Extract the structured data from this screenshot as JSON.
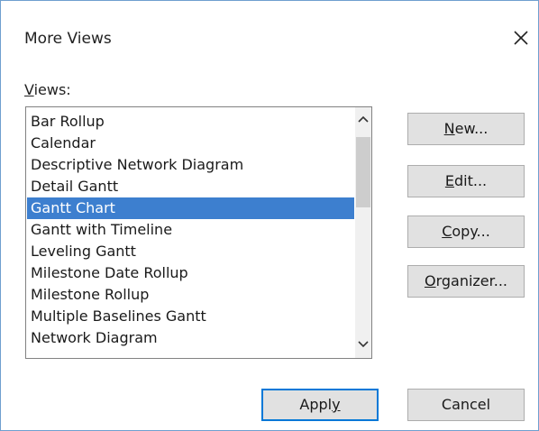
{
  "dialog": {
    "title": "More Views",
    "close_glyph": "close-icon"
  },
  "views_label": {
    "mnemonic": "V",
    "rest": "iews:"
  },
  "views_list": {
    "items": [
      "Bar Rollup",
      "Calendar",
      "Descriptive Network Diagram",
      "Detail Gantt",
      "Gantt Chart",
      "Gantt with Timeline",
      "Leveling Gantt",
      "Milestone Date Rollup",
      "Milestone Rollup",
      "Multiple Baselines Gantt",
      "Network Diagram"
    ],
    "selected": "Gantt Chart",
    "selection_color": "#3d7fcf"
  },
  "buttons": {
    "new": {
      "mnemonic": "N",
      "rest": "ew..."
    },
    "edit": {
      "mnemonic": "E",
      "rest": "dit..."
    },
    "copy": {
      "mnemonic": "C",
      "rest": "opy..."
    },
    "organizer": {
      "mnemonic": "O",
      "rest": "rganizer..."
    },
    "apply": {
      "before": "Appl",
      "mnemonic": "y"
    },
    "cancel": {
      "label": "Cancel"
    }
  },
  "accent_color": "#0078d7"
}
